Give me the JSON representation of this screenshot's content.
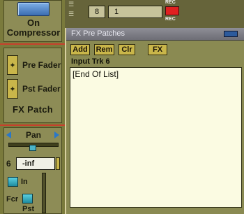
{
  "strip": {
    "compressor_on": "On",
    "compressor_label": "Compressor",
    "pre_fader_label": "Pre Fader",
    "post_fader_label": "Pst Fader",
    "fx_patch_label": "FX Patch",
    "pan_label": "Pan",
    "channel_number": "6",
    "level_value": "-inf",
    "in_label": "In",
    "fcr_label": "Fcr",
    "pst_label": "Pst"
  },
  "track_row": {
    "track_number": "8",
    "track_name": "1",
    "rec_label": "REC",
    "rec_label_top": "REC"
  },
  "fx_window": {
    "title": "FX Pre Patches",
    "buttons": [
      "Add",
      "Rem",
      "Clr",
      "FX"
    ],
    "subtitle": "Input Trk 6",
    "items": [
      "[End Of List]"
    ]
  },
  "colors": {
    "accent_blue": "#3a6cb0",
    "rec_red": "#e02020",
    "button_gold": "#c9b64a",
    "list_bg": "#fbfbe2"
  }
}
